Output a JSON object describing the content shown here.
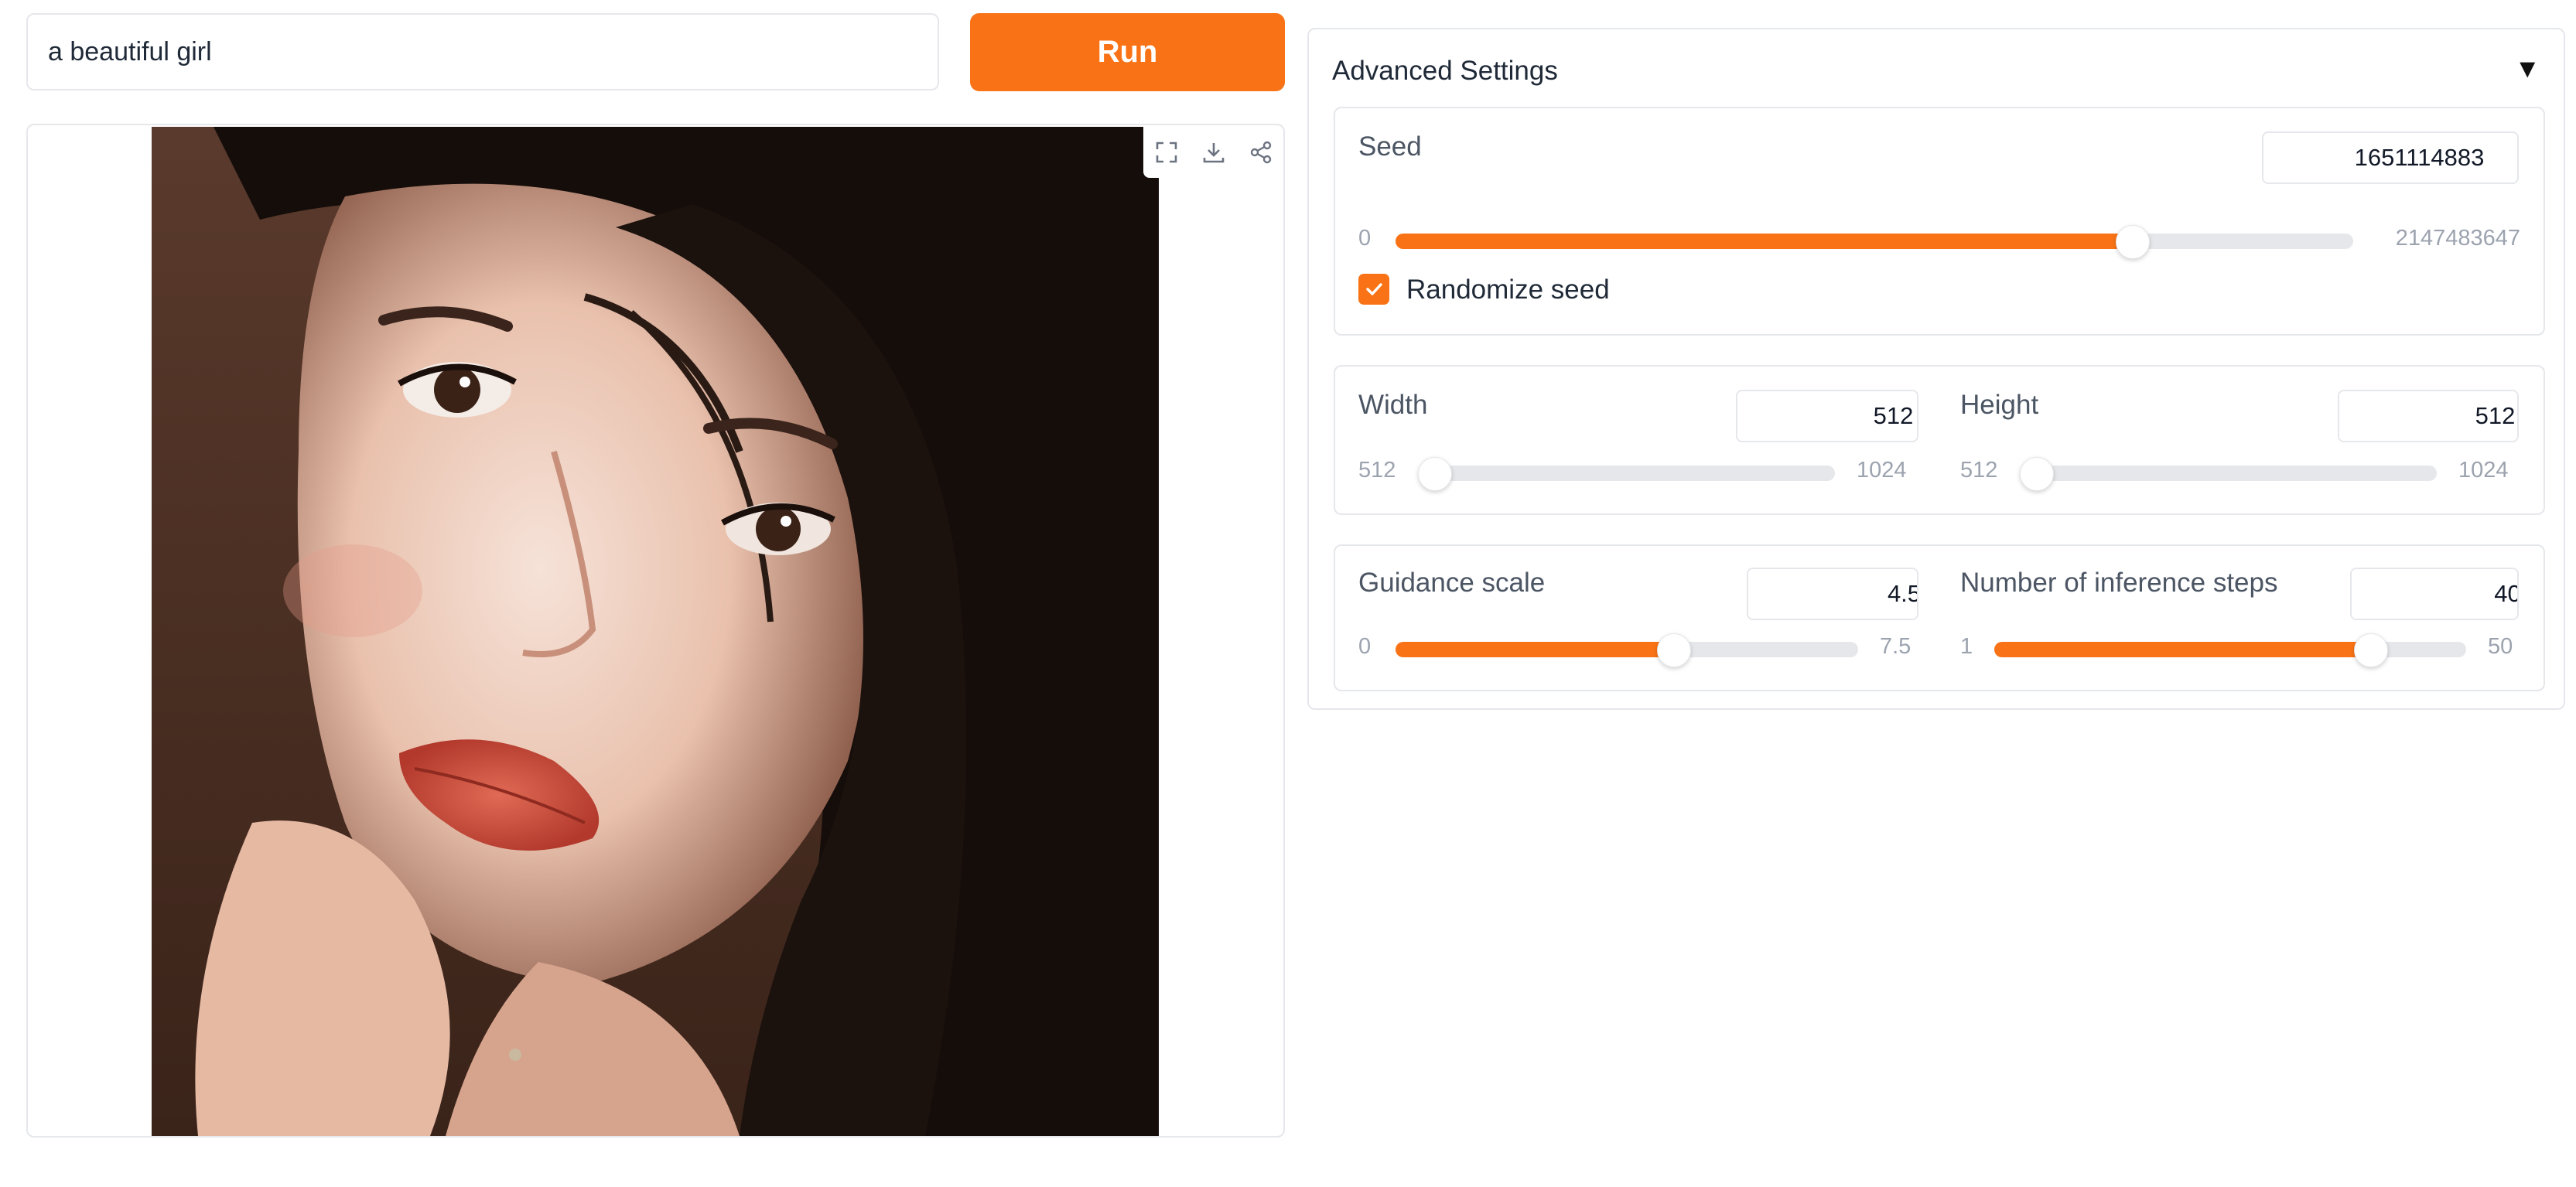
{
  "prompt": {
    "value": "a beautiful girl"
  },
  "run_button": {
    "label": "Run"
  },
  "image_toolbar": {
    "icons": [
      "fullscreen-icon",
      "download-icon",
      "share-icon"
    ]
  },
  "advanced": {
    "title": "Advanced Settings",
    "toggle_glyph": "▼",
    "seed": {
      "label": "Seed",
      "value": "1651114883",
      "min": "0",
      "max": "2147483647",
      "fraction": 0.769
    },
    "randomize": {
      "label": "Randomize seed",
      "checked": true
    },
    "width": {
      "label": "Width",
      "value": "512",
      "min": "512",
      "max": "1024",
      "fraction": 0.0
    },
    "height": {
      "label": "Height",
      "value": "512",
      "min": "512",
      "max": "1024",
      "fraction": 0.0
    },
    "guidance": {
      "label": "Guidance scale",
      "value": "4.5",
      "min": "0",
      "max": "7.5",
      "fraction": 0.6
    },
    "steps": {
      "label": "Number of inference steps",
      "value": "40",
      "min": "1",
      "max": "50",
      "fraction": 0.796
    }
  },
  "colors": {
    "accent": "#f97316",
    "track": "#e5e7eb",
    "border": "#e5e7eb"
  }
}
